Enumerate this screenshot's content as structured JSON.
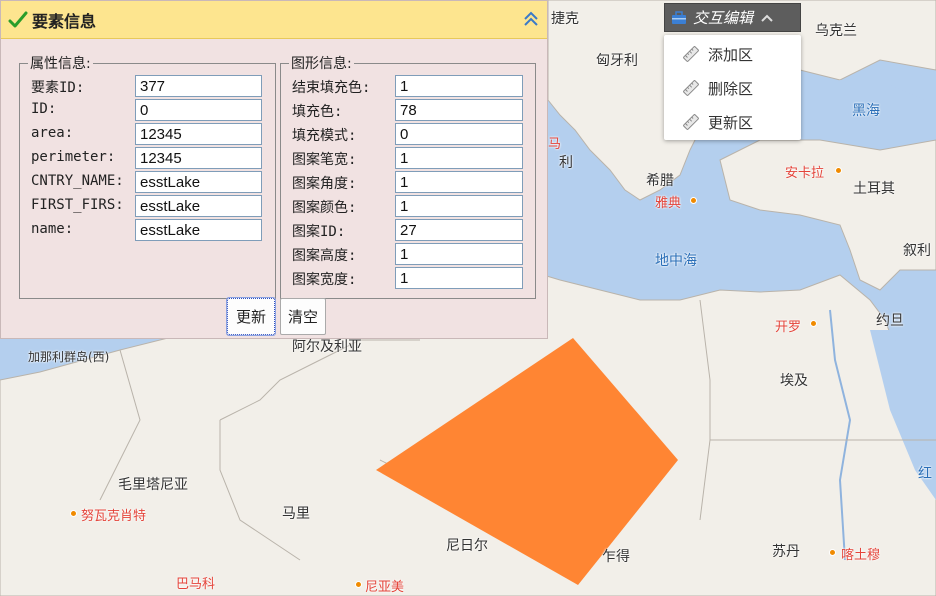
{
  "panel": {
    "title": "要素信息",
    "attr_group": {
      "legend": "属性信息:",
      "fields": [
        {
          "label": "要素ID:",
          "value": "377"
        },
        {
          "label": "ID:",
          "value": "0"
        },
        {
          "label": "area:",
          "value": "12345"
        },
        {
          "label": "perimeter:",
          "value": "12345"
        },
        {
          "label": "CNTRY_NAME:",
          "value": "esstLake"
        },
        {
          "label": "FIRST_FIRS:",
          "value": "esstLake"
        },
        {
          "label": "name:",
          "value": "esstLake"
        }
      ]
    },
    "style_group": {
      "legend": "图形信息:",
      "fields": [
        {
          "label": "结束填充色:",
          "value": "1"
        },
        {
          "label": "填充色:",
          "value": "78"
        },
        {
          "label": "填充模式:",
          "value": "0"
        },
        {
          "label": "图案笔宽:",
          "value": "1"
        },
        {
          "label": "图案角度:",
          "value": "1"
        },
        {
          "label": "图案颜色:",
          "value": "1"
        },
        {
          "label": "图案ID:",
          "value": "27"
        },
        {
          "label": "图案高度:",
          "value": "1"
        },
        {
          "label": "图案宽度:",
          "value": "1"
        }
      ]
    },
    "buttons": {
      "update": "更新",
      "clear": "清空"
    }
  },
  "edit_menu": {
    "title": "交互编辑",
    "items": [
      "添加区",
      "删除区",
      "更新区"
    ]
  },
  "map": {
    "labels": {
      "jieke": "捷克",
      "ukraine": "乌克兰",
      "hungary": "匈牙利",
      "black_sea": "黑海",
      "ankara": "安卡拉",
      "turkey": "土耳其",
      "li": "利",
      "greece": "希腊",
      "athens": "雅典",
      "syria": "叙利",
      "mediterranean": "地中海",
      "cairo": "开罗",
      "jordan": "约旦",
      "algeria": "阿尔及利亚",
      "canary": "加那利群岛(西)",
      "egypt": "埃及",
      "mauritania": "毛里塔尼亚",
      "nouakchott": "努瓦克肖特",
      "mali": "马里",
      "niger": "尼日尔",
      "chad": "乍得",
      "sudan": "苏丹",
      "khartoum": "喀土穆",
      "bamako": "巴马科",
      "niamey": "尼亚美",
      "hong": "红",
      "ma": "马"
    },
    "polygon_color": "#ff8533"
  }
}
